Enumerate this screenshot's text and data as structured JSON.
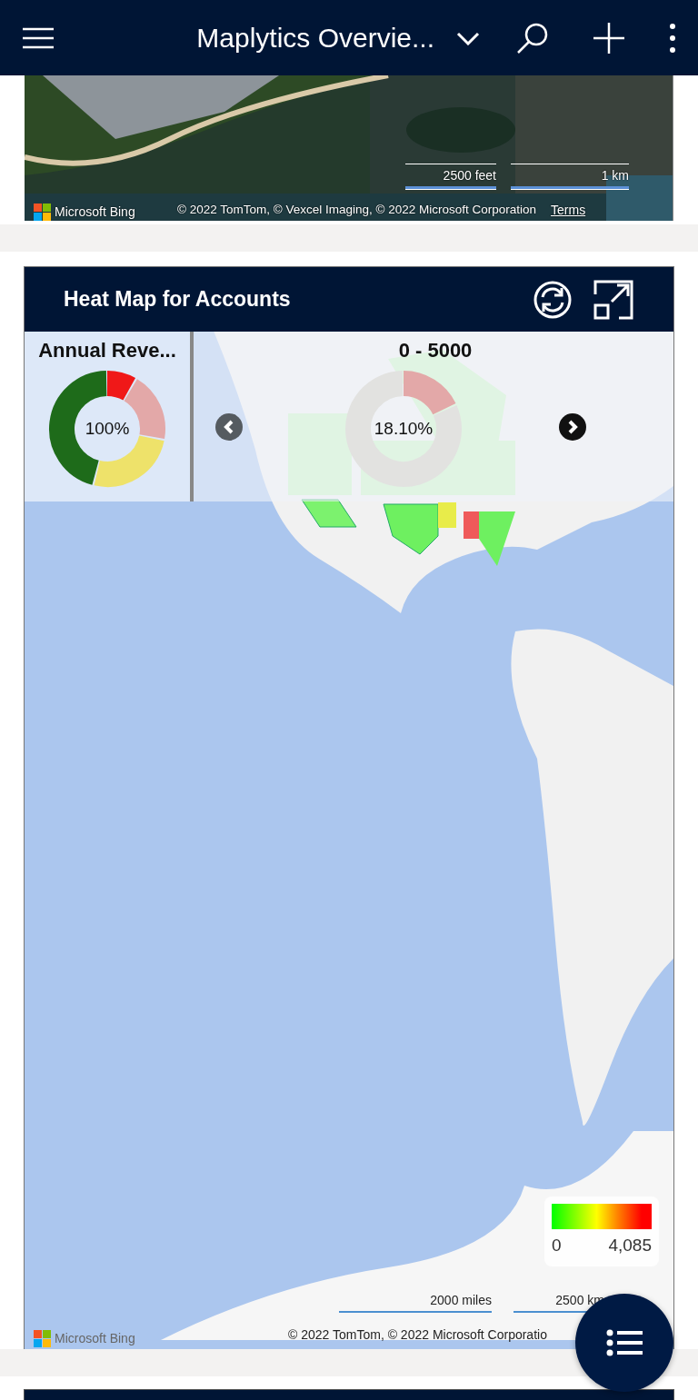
{
  "header": {
    "title": "Maplytics Overvie..."
  },
  "satellite_map": {
    "scale_labels": [
      "2500 feet",
      "1 km"
    ],
    "logo": "Microsoft Bing",
    "attribution": "© 2022 TomTom, © Vexcel Imaging, © 2022 Microsoft Corporation",
    "terms": "Terms"
  },
  "heat_map": {
    "title": "Heat Map for Accounts",
    "summary": {
      "title": "Annual Reve...",
      "center_label": "100%"
    },
    "carousel": {
      "range": "0 - 5000",
      "center_label": "18.10%"
    },
    "legend": {
      "min": "0",
      "max": "4,085"
    },
    "scale_labels": [
      "2000 miles",
      "2500 km"
    ],
    "logo": "Microsoft Bing",
    "attribution": "© 2022 TomTom, © 2022 Microsoft Corporatio"
  }
}
